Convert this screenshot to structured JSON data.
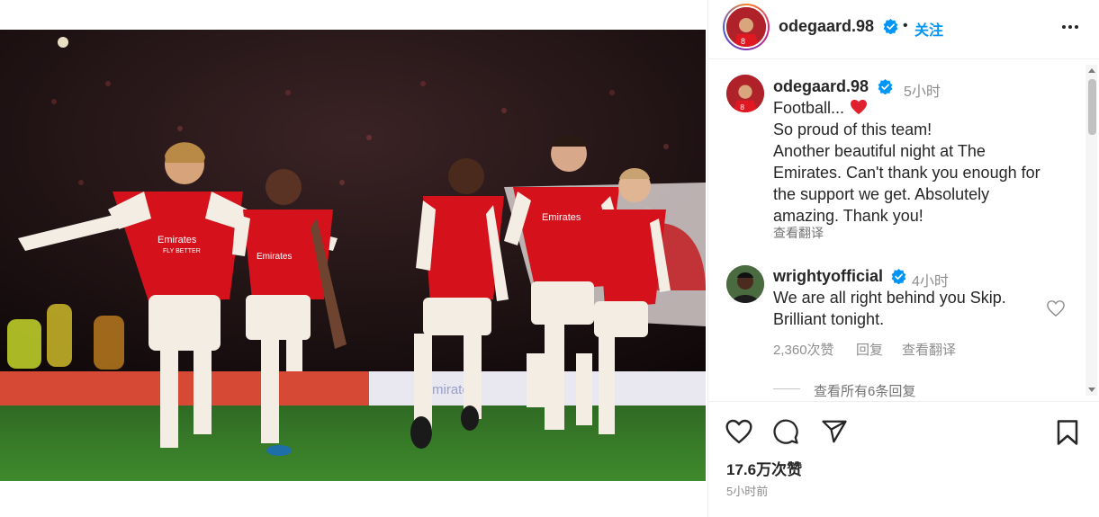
{
  "post": {
    "author": "odegaard.98",
    "follow_label": "关注",
    "dot": "•",
    "more_icon": "more-horizontal-icon",
    "likes": "17.6万次赞",
    "time_ago": "5小时前"
  },
  "caption": {
    "username": "odegaard.98",
    "time": "5小时",
    "line1": "Football...",
    "line2": "So proud of this team!",
    "line3": "Another beautiful night at The",
    "line4": "Emirates. Can't thank you enough for",
    "line5": "the support we get. Absolutely",
    "line6": "amazing. Thank you!",
    "see_translation": "查看翻译"
  },
  "comment": {
    "username": "wrightyofficial",
    "time": "4小时",
    "line1": "We are all right behind you Skip.",
    "line2": "Brilliant tonight.",
    "likes": "2,360次赞",
    "reply": "回复",
    "see_translation": "查看翻译",
    "view_replies": "查看所有6条回复"
  },
  "photo": {
    "board_text": "Emirates",
    "shirt_text_1": "Emirates",
    "shirt_text_2": "FLY BETTER"
  },
  "colors": {
    "verified": "#0095f6",
    "heart": "#ed4956",
    "arsenal_red": "#d5111b"
  }
}
